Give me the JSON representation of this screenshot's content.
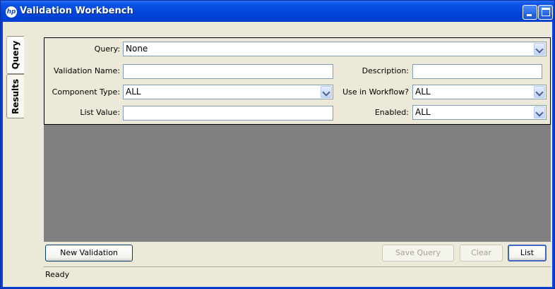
{
  "window": {
    "title": "Validation Workbench",
    "app_icon_text": "hp"
  },
  "tabs": [
    {
      "label": "Query",
      "selected": true
    },
    {
      "label": "Results",
      "selected": false
    }
  ],
  "query_form": {
    "query": {
      "label": "Query:",
      "value": "None"
    },
    "validation_name": {
      "label": "Validation Name:",
      "value": ""
    },
    "description": {
      "label": "Description:",
      "value": ""
    },
    "component_type": {
      "label": "Component Type:",
      "value": "ALL"
    },
    "use_in_workflow": {
      "label": "Use in Workflow?",
      "value": "ALL"
    },
    "list_value": {
      "label": "List Value:",
      "value": ""
    },
    "enabled": {
      "label": "Enabled:",
      "value": "ALL"
    }
  },
  "buttons": {
    "new_validation": "New Validation",
    "save_query": "Save Query",
    "clear": "Clear",
    "list": "List"
  },
  "status": "Ready",
  "colors": {
    "titlebar": "#0245d9",
    "results_background": "#808080",
    "panel_background": "#ece9d8"
  }
}
